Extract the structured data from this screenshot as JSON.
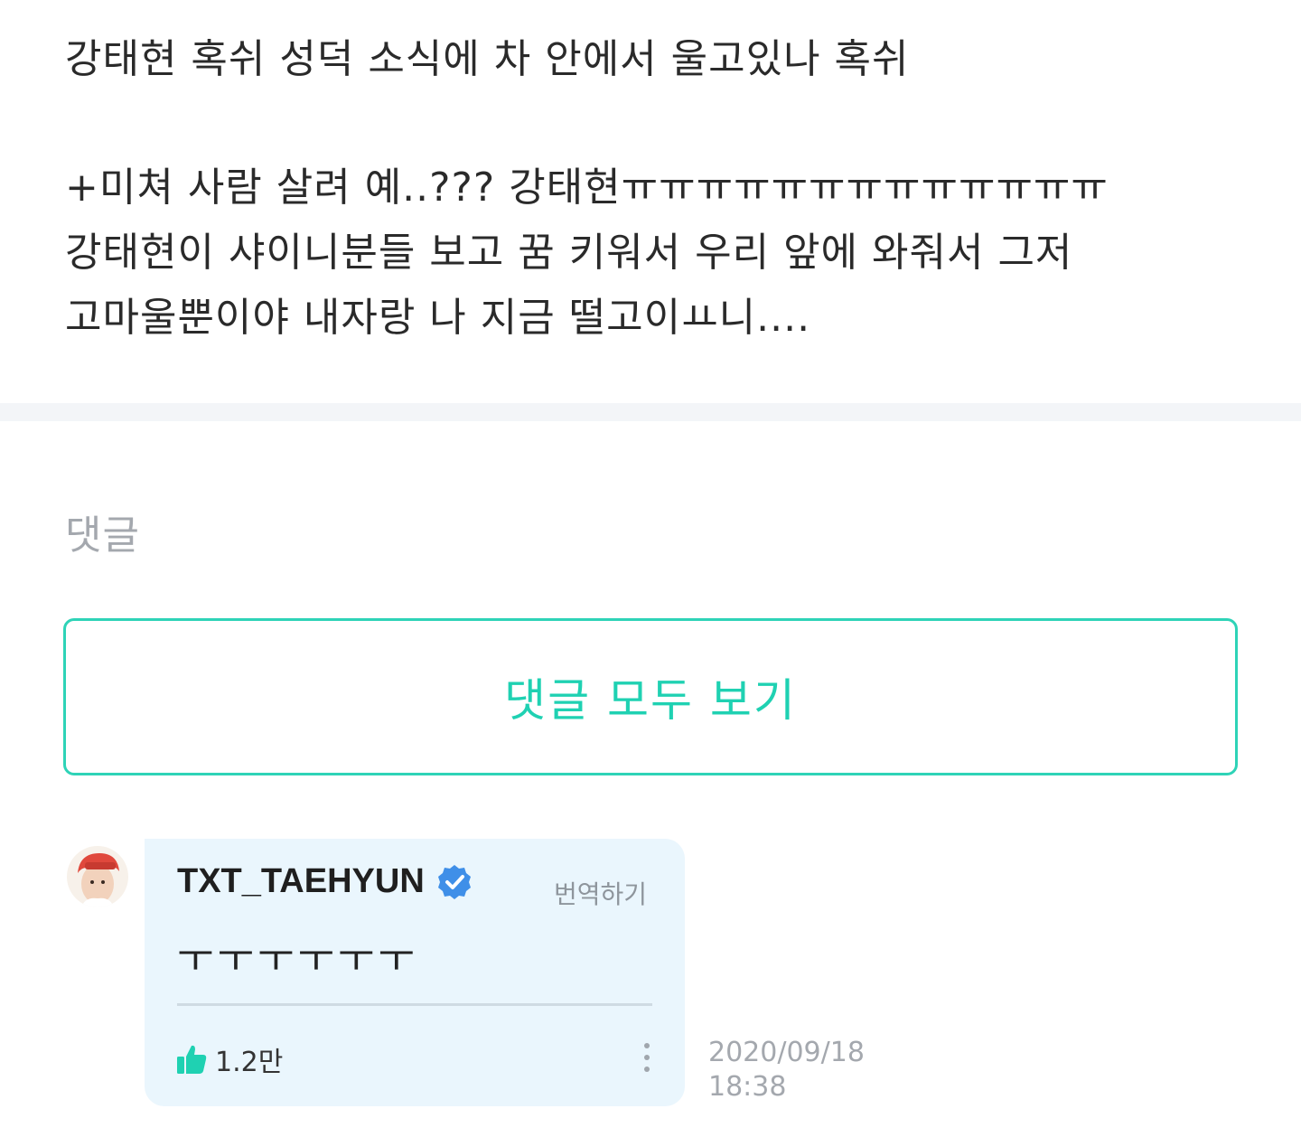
{
  "post": {
    "line1": "강태현 혹쉬 성덕 소식에 차 안에서 울고있나 혹쉬",
    "line2": "+미쳐 사람 살려 예..??? 강태현ㅠㅠㅠㅠㅠㅠㅠㅠㅠㅠㅠㅠㅠ",
    "line3": "강태현이 샤이니분들 보고 꿈 키워서 우리 앞에 와줘서 그저",
    "line4": "고마울뿐이야 내자랑 나 지금 떨고이ㅛ니...."
  },
  "comments_section": {
    "label": "댓글",
    "view_all_label": "댓글 모두 보기"
  },
  "comment": {
    "author": "TXT_TAEHYUN",
    "translate_label": "번역하기",
    "text": "ㅜㅜㅜㅜㅜㅜ",
    "like_count": "1.2만",
    "date": "2020/09/18",
    "time": "18:38",
    "verified": true
  },
  "icons": {
    "verified": "verified-badge-icon",
    "like": "thumbs-up-icon",
    "more": "more-vertical-icon"
  },
  "colors": {
    "accent": "#1fd1b2",
    "card_bg": "#eaf6fd",
    "verified": "#3f8fe8",
    "muted": "#a4a8ae"
  }
}
